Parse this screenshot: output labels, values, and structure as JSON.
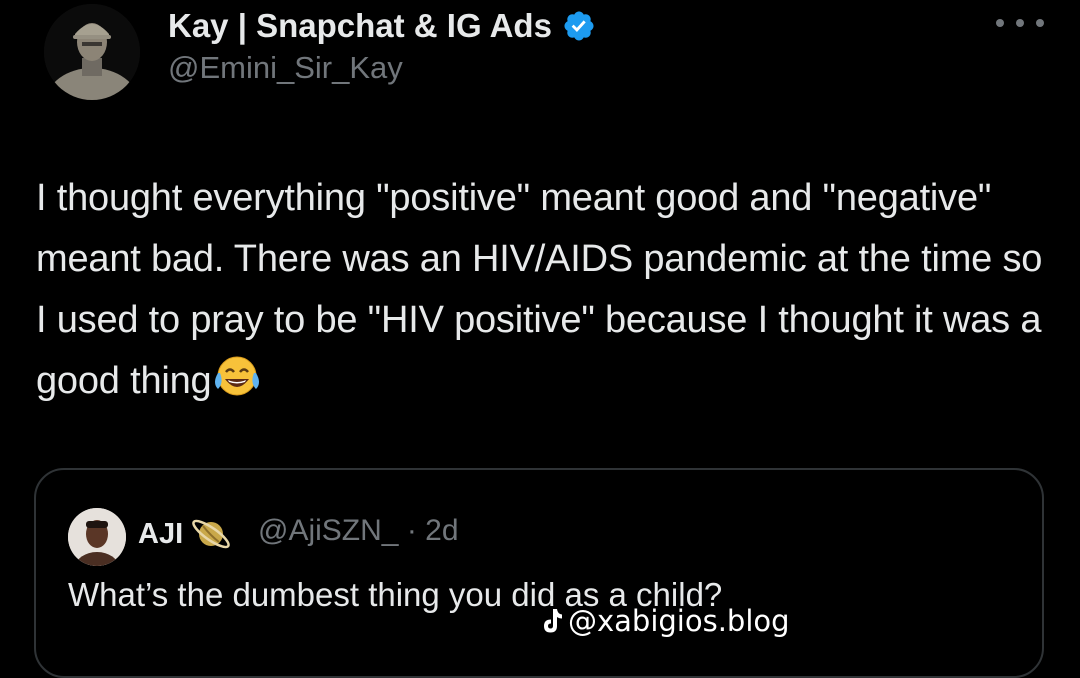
{
  "author": {
    "display_name": "Kay | Snapchat & IG Ads",
    "handle": "@Emini_Sir_Kay",
    "verified": true,
    "avatar_icon": "profile-photo"
  },
  "tweet": {
    "text_before_emoji": "I thought everything \"positive\" meant good and \"negative\" meant bad. There was an HIV/AIDS pandemic at the time so I used to pray to be \"HIV positive\" because I thought it was a good thing",
    "emoji": "face-with-tears-of-joy"
  },
  "quoted_tweet": {
    "display_name": "AJI",
    "badge_icon": "ringed-planet-emoji",
    "handle_and_time": "@AjiSZN_ · 2d",
    "text": "What’s the dumbest thing you did as a child?",
    "avatar_icon": "profile-photo"
  },
  "watermark": {
    "text": "@xabigios.blog",
    "icon": "tiktok-icon"
  },
  "colors": {
    "background": "#000000",
    "primary_text": "#e7e9ea",
    "secondary_text": "#71767b",
    "verified_blue": "#1d9bf0",
    "border": "#2f3336"
  }
}
